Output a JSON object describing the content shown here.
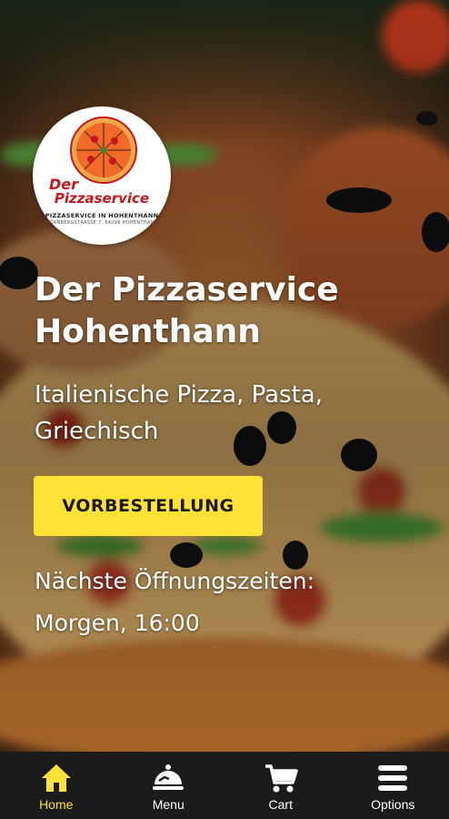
{
  "logo": {
    "name_line1": "Der",
    "name_line2": "Pizzaservice",
    "tagline": "PIZZASERVICE IN HOHENTHANN",
    "address": "DÖRNBERGSTRASSE 7, 84098 HOHENTHANN"
  },
  "hero": {
    "title": "Der Pizzaservice Hohenthann",
    "subtitle": "Italienische Pizza, Pasta, Griechisch",
    "cta_label": "VORBESTELLUNG",
    "hours_label": "Nächste Öffnungszeiten:",
    "hours_value": "Morgen, 16:00"
  },
  "nav": {
    "items": [
      {
        "label": "Home",
        "icon": "home-icon",
        "active": true
      },
      {
        "label": "Menu",
        "icon": "cloche-icon",
        "active": false
      },
      {
        "label": "Cart",
        "icon": "cart-icon",
        "active": false
      },
      {
        "label": "Options",
        "icon": "hamburger-menu-icon",
        "active": false
      }
    ]
  },
  "colors": {
    "accent": "#ffe236",
    "nav_background": "#1b1b1b",
    "logo_red": "#c8161d"
  }
}
